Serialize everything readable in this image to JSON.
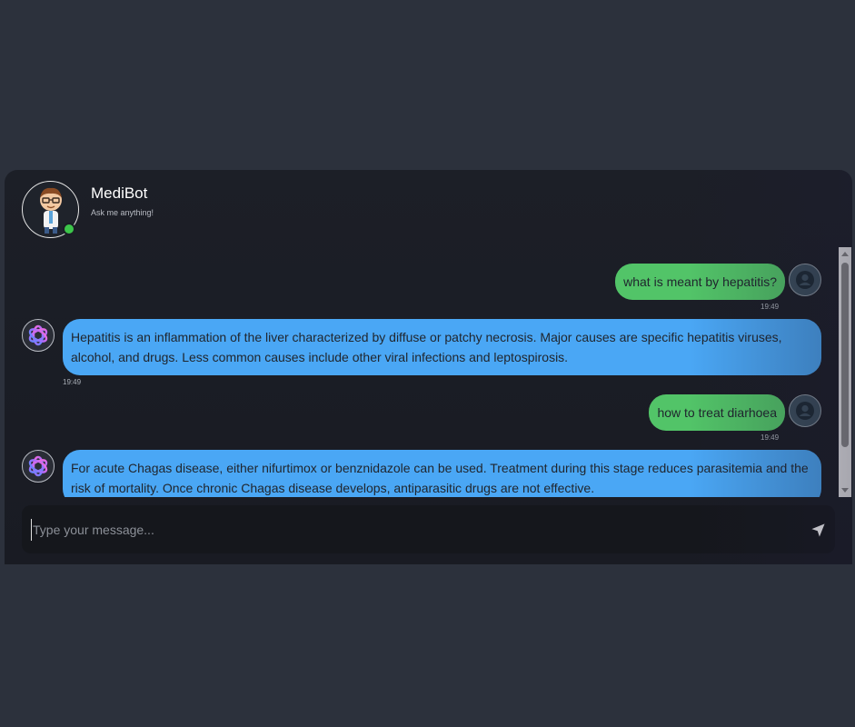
{
  "header": {
    "bot_name": "MediBot",
    "subtitle": "Ask me anything!",
    "avatar_icon": "doctor-avatar-icon",
    "status": "online",
    "status_color": "#3cc64a"
  },
  "messages": [
    {
      "sender": "user",
      "text": "what is meant by hepatitis?",
      "time": "19:49"
    },
    {
      "sender": "bot",
      "text": "Hepatitis is an inflammation of the liver characterized by diffuse or patchy necrosis. Major causes are specific hepatitis viruses, alcohol, and drugs. Less common causes include other viral infections and leptospirosis.",
      "time": "19:49"
    },
    {
      "sender": "user",
      "text": "how to treat diarhoea",
      "time": "19:49"
    },
    {
      "sender": "bot",
      "text": "For acute Chagas disease, either nifurtimox or benznidazole can be used. Treatment during this stage reduces parasitemia and the risk of mortality. Once chronic Chagas disease develops, antiparasitic drugs are not effective.",
      "time": ""
    }
  ],
  "input": {
    "placeholder": "Type your message...",
    "value": ""
  },
  "colors": {
    "user_bubble": "#52c468",
    "bot_bubble": "#4aa7f5",
    "background": "#2c313c",
    "card": "#1c1f27"
  }
}
